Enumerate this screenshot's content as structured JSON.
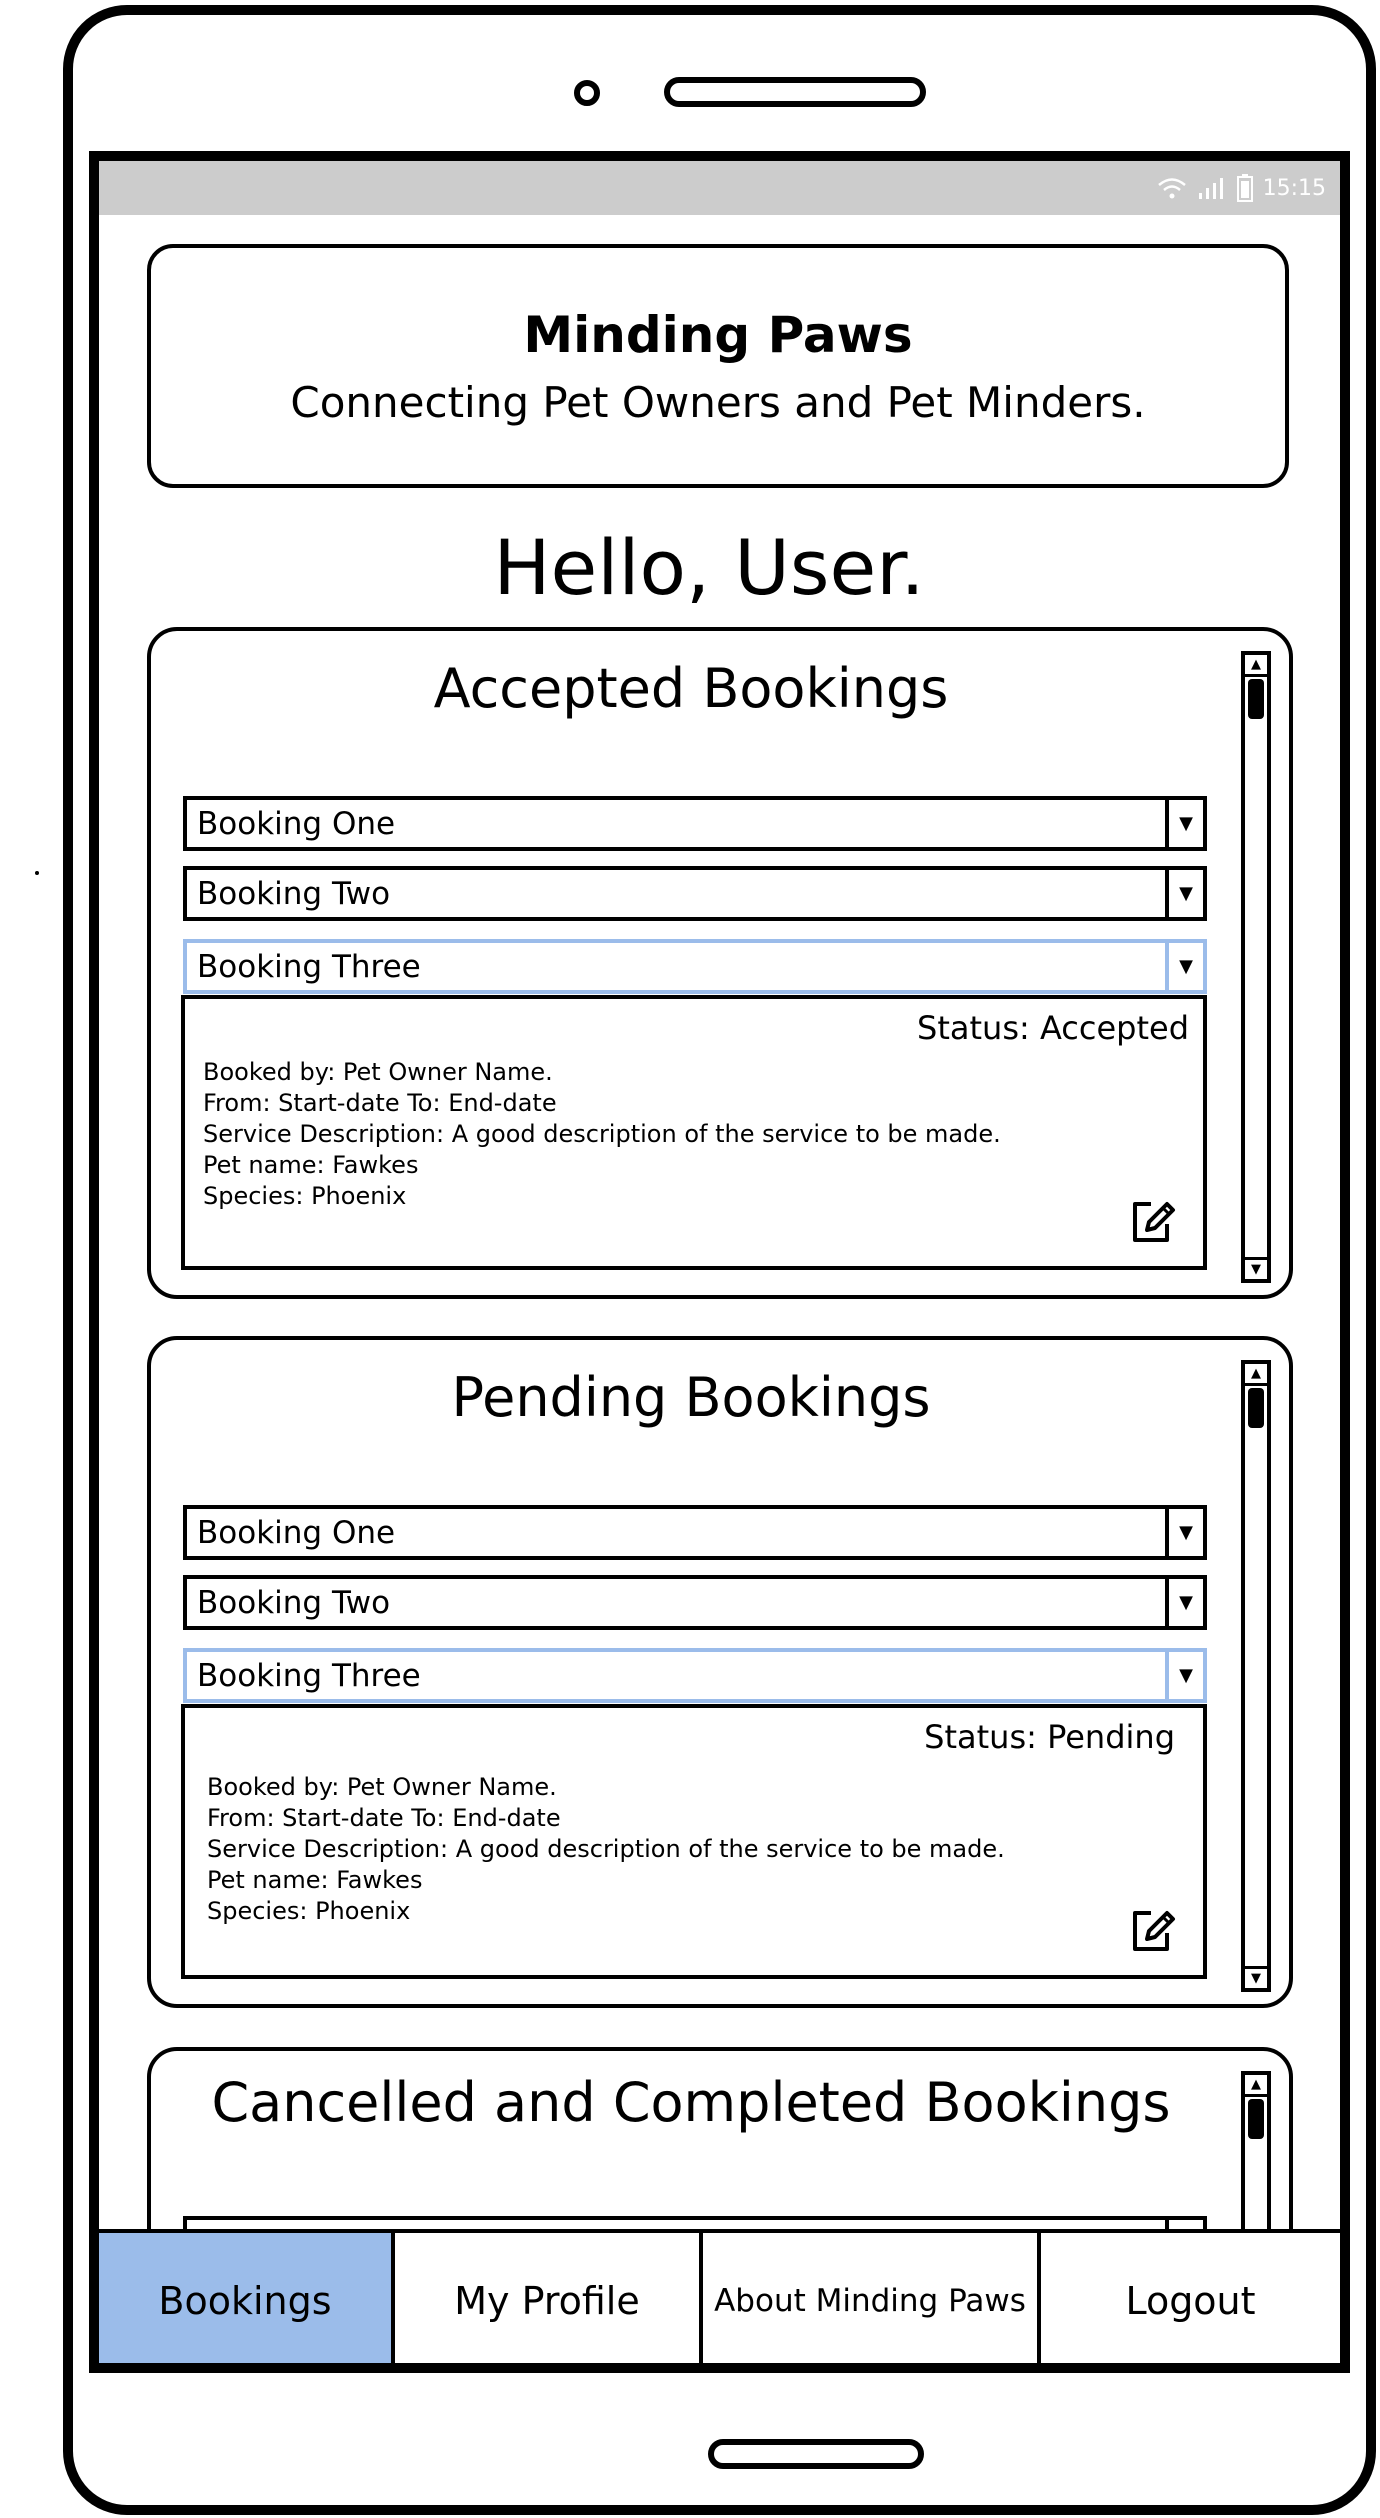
{
  "status_bar": {
    "time": "15:15",
    "icons": [
      "wifi-icon",
      "signal-icon",
      "battery-icon"
    ]
  },
  "header": {
    "title": "Minding Paws",
    "subtitle": "Connecting Pet Owners and Pet Minders."
  },
  "greeting": "Hello, User.",
  "accepted": {
    "title": "Accepted Bookings",
    "bookings": [
      {
        "label": "Booking One"
      },
      {
        "label": "Booking Two"
      },
      {
        "label": "Booking Three",
        "selected": true
      }
    ],
    "detail": {
      "status": "Status: Accepted",
      "lines": [
        "Booked by: Pet Owner Name.",
        "From: Start-date To: End-date",
        "Service Description: A good description of the service to be made.",
        "Pet name: Fawkes",
        "Species: Phoenix"
      ]
    }
  },
  "pending": {
    "title": "Pending Bookings",
    "bookings": [
      {
        "label": "Booking One"
      },
      {
        "label": "Booking Two"
      },
      {
        "label": "Booking Three",
        "selected": true
      }
    ],
    "detail": {
      "status": "Status: Pending",
      "lines": [
        "Booked by: Pet Owner Name.",
        "From: Start-date To: End-date",
        "Service Description: A good description of the service to be made.",
        "Pet name: Fawkes",
        "Species: Phoenix"
      ]
    }
  },
  "cancelled": {
    "title": "Cancelled and Completed Bookings"
  },
  "tabs": [
    {
      "label": "Bookings",
      "active": true
    },
    {
      "label": "My Profile"
    },
    {
      "label": "About Minding Paws"
    },
    {
      "label": "Logout"
    }
  ],
  "colors": {
    "accent": "#9bbcea",
    "status_bar": "#cccccc",
    "outline": "#000000"
  }
}
